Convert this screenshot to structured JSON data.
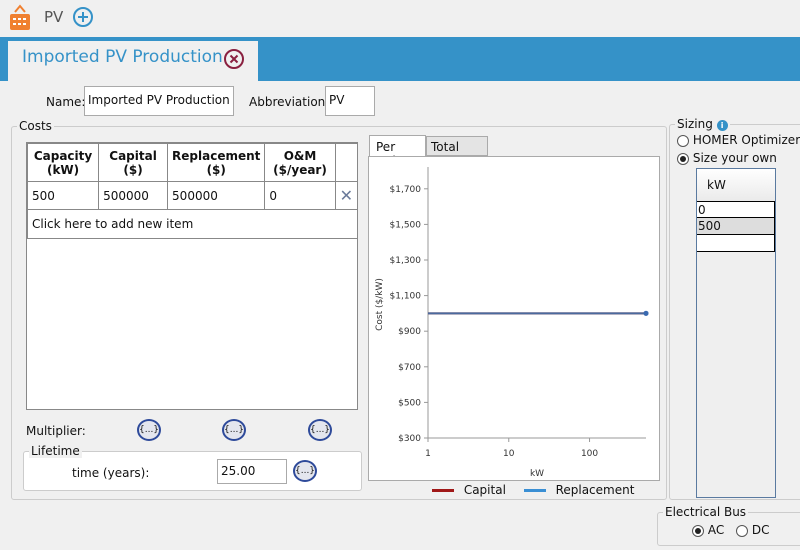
{
  "header": {
    "component_label": "PV",
    "icon": "solar-panel-icon",
    "add_icon": "plus-circle-icon"
  },
  "tab": {
    "title": "Imported PV Production",
    "close_icon": "close-circle-icon"
  },
  "form": {
    "name_label": "Name:",
    "name_value": "Imported PV Production",
    "abbr_label": "Abbreviation:",
    "abbr_value": "PV"
  },
  "costs": {
    "title": "Costs",
    "columns": [
      [
        "Capacity",
        "(kW)"
      ],
      [
        "Capital",
        "($)"
      ],
      [
        "Replacement",
        "($)"
      ],
      [
        "O&M",
        "($/year)"
      ]
    ],
    "rows": [
      {
        "capacity": "500",
        "capital": "500000",
        "replacement": "500000",
        "om": "0"
      }
    ],
    "add_item": "Click here to add new item",
    "multiplier_label": "Multiplier:",
    "multiplier_button": "{...}"
  },
  "lifetime": {
    "title": "Lifetime",
    "label": "time (years):",
    "value": "25.00",
    "button": "{...}"
  },
  "chart_tabs": [
    "Per Unit",
    "Total Cost"
  ],
  "chart_data": {
    "type": "line",
    "xlabel": "kW",
    "ylabel": "Cost ($/kW)",
    "xscale": "log",
    "xlim": [
      1,
      500
    ],
    "ylim": [
      300,
      1800
    ],
    "xticks": [
      "1",
      "10",
      "100"
    ],
    "yticks": [
      "$1,700",
      "$1,500",
      "$1,300",
      "$1,100",
      "$900",
      "$700",
      "$500",
      "$300"
    ],
    "series": [
      {
        "name": "Capital",
        "color": "#a01818",
        "x": [
          1,
          500
        ],
        "y": [
          1000,
          1000
        ]
      },
      {
        "name": "Replacement",
        "color": "#3a8fd4",
        "x": [
          1,
          500
        ],
        "y": [
          1000,
          1000
        ]
      }
    ],
    "legend": "bottom"
  },
  "sizing": {
    "title": "Sizing",
    "info_icon": "info-icon",
    "options": [
      "HOMER Optimizer™",
      "Size your own"
    ],
    "selected": "Size your own",
    "column": "kW",
    "values": [
      "0",
      "500",
      ""
    ]
  },
  "bus": {
    "title": "Electrical Bus",
    "options": [
      "AC",
      "DC"
    ],
    "selected": "AC"
  }
}
